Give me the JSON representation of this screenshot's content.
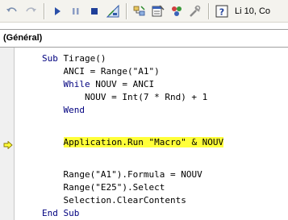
{
  "toolbar": {
    "buttons": [
      {
        "name": "undo-icon"
      },
      {
        "name": "redo-icon"
      },
      {
        "name": "run-icon"
      },
      {
        "name": "break-icon"
      },
      {
        "name": "reset-icon"
      },
      {
        "name": "design-mode-icon"
      },
      {
        "name": "project-explorer-icon"
      },
      {
        "name": "properties-window-icon"
      },
      {
        "name": "object-browser-icon"
      },
      {
        "name": "toolbox-icon"
      },
      {
        "name": "help-icon"
      }
    ],
    "position_text": "Li 10, Co"
  },
  "procedure_combo": {
    "selected": "(Général)"
  },
  "code": {
    "lines": [
      {
        "indent": "",
        "kw": "Sub",
        "rest": " Tirage()"
      },
      {
        "indent": "    ",
        "kw": "",
        "rest": "ANCI = Range(\"A1\")"
      },
      {
        "indent": "    ",
        "kw": "While",
        "rest": " NOUV = ANCI"
      },
      {
        "indent": "        ",
        "kw": "",
        "rest": "NOUV = Int(7 * Rnd) + 1"
      },
      {
        "indent": "    ",
        "kw": "Wend",
        "rest": ""
      },
      {
        "indent": "",
        "kw": "",
        "rest": ""
      },
      {
        "indent": "    ",
        "kw": "",
        "rest": "Application.Run \"Macro\" & NOUV"
      },
      {
        "indent": "",
        "kw": "",
        "rest": ""
      },
      {
        "indent": "    ",
        "kw": "",
        "rest": "Range(\"A1\").Formula = NOUV"
      },
      {
        "indent": "    ",
        "kw": "",
        "rest": "Range(\"E25\").Select"
      },
      {
        "indent": "    ",
        "kw": "",
        "rest": "Selection.ClearContents"
      },
      {
        "indent": "",
        "kw": "End Sub",
        "rest": ""
      }
    ],
    "current_line_index": 6,
    "highlight_color": "#ffff3a",
    "keyword_color": "#00007f"
  }
}
